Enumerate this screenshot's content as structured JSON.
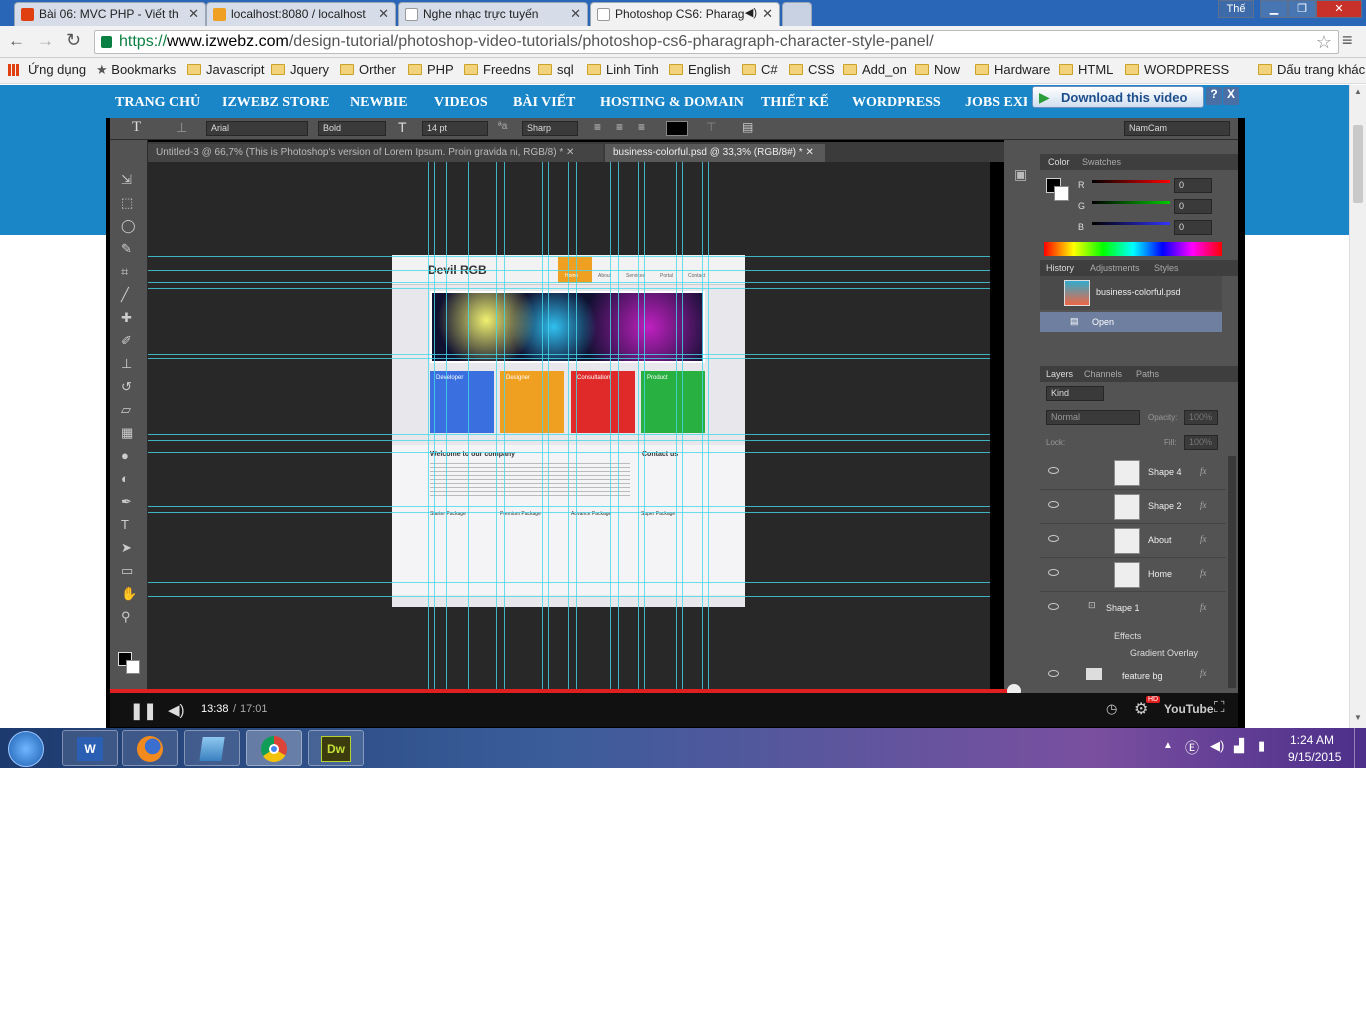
{
  "browser": {
    "tabs": [
      {
        "title": "Bài 06: MVC PHP - Viết th",
        "active": false,
        "icon_color": "#e04010"
      },
      {
        "title": "localhost:8080 / localhost",
        "active": false,
        "icon_color": "#f0a020"
      },
      {
        "title": "Nghe nhạc trực tuyến",
        "active": false,
        "icon_color": "#cccccc"
      },
      {
        "title": "Photoshop CS6: Pharag",
        "active": true,
        "icon_color": "#cccccc"
      }
    ],
    "profile_label": "Thế",
    "url_protocol": "https://",
    "url_host": "www.izwebz.com",
    "url_path": "/design-tutorial/photoshop-video-tutorials/photoshop-cs6-pharagraph-character-style-panel/",
    "apps_label": "Ứng dụng",
    "bookmarks_label": "Bookmarks",
    "bookmark_folders": [
      "Javascript",
      "Jquery",
      "Orther",
      "PHP",
      "Freedns",
      "sql",
      "Linh Tinh",
      "English",
      "C#",
      "CSS",
      "Add_on",
      "Now",
      "Hardware",
      "HTML",
      "WORDPRESS"
    ],
    "other_bookmarks": "Dấu trang khác"
  },
  "site": {
    "menu": [
      "TRANG CHỦ",
      "IZWEBZ STORE",
      "NEWBIE",
      "VIDEOS",
      "BÀI VIẾT",
      "HOSTING & DOMAIN",
      "THIẾT KẾ",
      "WORDPRESS",
      "JOBS EXP"
    ],
    "download_label": "Download this video",
    "download_help": "?",
    "download_close": "X"
  },
  "photoshop": {
    "font_family": "Arial",
    "font_style": "Bold",
    "font_size": "14 pt",
    "antialias": "Sharp",
    "workspace": "NamCam",
    "doc_tabs": [
      {
        "title": "Untitled-3 @ 66,7% (This is Photoshop's version  of Lorem Ipsum.  Proin gravida ni, RGB/8) *",
        "active": false
      },
      {
        "title": "business-colorful.psd @ 33,3% (RGB/8#) *",
        "active": true
      }
    ],
    "color_panel": {
      "tabs": [
        "Color",
        "Swatches"
      ],
      "channels": [
        {
          "label": "R",
          "value": "0"
        },
        {
          "label": "G",
          "value": "0"
        },
        {
          "label": "B",
          "value": "0"
        }
      ]
    },
    "history_panel": {
      "tabs": [
        "History",
        "Adjustments",
        "Styles"
      ],
      "snapshot": "business-colorful.psd",
      "steps": [
        "Open"
      ]
    },
    "layers_panel": {
      "tabs": [
        "Layers",
        "Channels",
        "Paths"
      ],
      "filter": "Kind",
      "blend_mode": "Normal",
      "opacity_label": "Opacity:",
      "opacity_value": "100%",
      "lock_label": "Lock:",
      "fill_label": "Fill:",
      "fill_value": "100%",
      "layers": [
        "Shape 4",
        "Shape 2",
        "About",
        "Home",
        "Shape 1"
      ],
      "effects_label": "Effects",
      "effect_item": "Gradient Overlay",
      "last_layer": "feature bg",
      "fx_label": "fx"
    },
    "mockup": {
      "logo": "Devil RGB",
      "nav": [
        "Home",
        "About",
        "Services",
        "Portal",
        "Contact"
      ],
      "cards": [
        {
          "title": "Developer",
          "color": "#3a6fe0"
        },
        {
          "title": "Designer",
          "color": "#f0a020"
        },
        {
          "title": "Consultation",
          "color": "#e02a2a"
        },
        {
          "title": "Product",
          "color": "#28b040"
        }
      ],
      "welcome": "Welcome to our company",
      "contact": "Contact us",
      "packages": [
        "Starter Package",
        "Premium Package",
        "Advance Package",
        "Super Package"
      ]
    }
  },
  "video": {
    "current_time": "13:38",
    "duration": "17:01",
    "progress": 0.801,
    "youtube_label": "YouTube",
    "hd_badge": "HD"
  },
  "taskbar": {
    "time": "1:24 AM",
    "date": "9/15/2015",
    "apps": [
      "word",
      "firefox",
      "file-manager",
      "chrome",
      "dreamweaver"
    ],
    "dw_label": "Dw"
  }
}
